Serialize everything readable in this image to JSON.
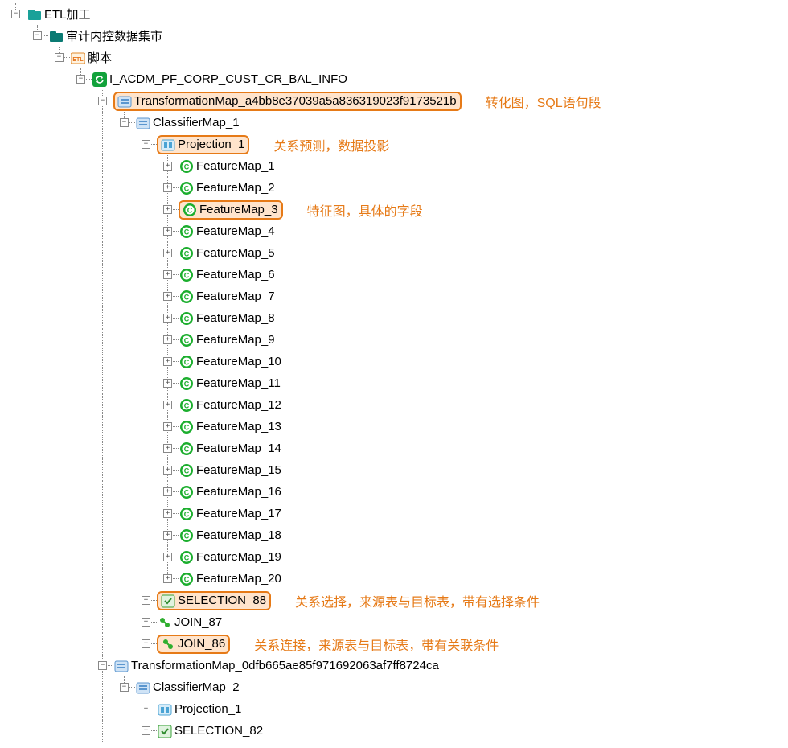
{
  "tree": {
    "root": "ETL加工",
    "mart": "审计内控数据集市",
    "script": "脚本",
    "job": "I_ACDM_PF_CORP_CUST_CR_BAL_INFO",
    "tmap1": "TransformationMap_a4bb8e37039a5a836319023f9173521b",
    "cmap1": "ClassifierMap_1",
    "proj1": "Projection_1",
    "features": [
      "FeatureMap_1",
      "FeatureMap_2",
      "FeatureMap_3",
      "FeatureMap_4",
      "FeatureMap_5",
      "FeatureMap_6",
      "FeatureMap_7",
      "FeatureMap_8",
      "FeatureMap_9",
      "FeatureMap_10",
      "FeatureMap_11",
      "FeatureMap_12",
      "FeatureMap_13",
      "FeatureMap_14",
      "FeatureMap_15",
      "FeatureMap_16",
      "FeatureMap_17",
      "FeatureMap_18",
      "FeatureMap_19",
      "FeatureMap_20"
    ],
    "selection88": "SELECTION_88",
    "join87": "JOIN_87",
    "join86": "JOIN_86",
    "tmap2": "TransformationMap_0dfb665ae85f971692063af7ff8724ca",
    "cmap2": "ClassifierMap_2",
    "proj2": "Projection_1",
    "sel82": "SELECTION_82"
  },
  "annot": {
    "tmap": "转化图，SQL语句段",
    "proj": "关系预测，数据投影",
    "feat": "特征图，具体的字段",
    "sel": "关系选择，来源表与目标表，带有选择条件",
    "join": "关系连接，来源表与目标表，带有关联条件"
  },
  "glyph": {
    "plus": "+",
    "minus": "−"
  }
}
